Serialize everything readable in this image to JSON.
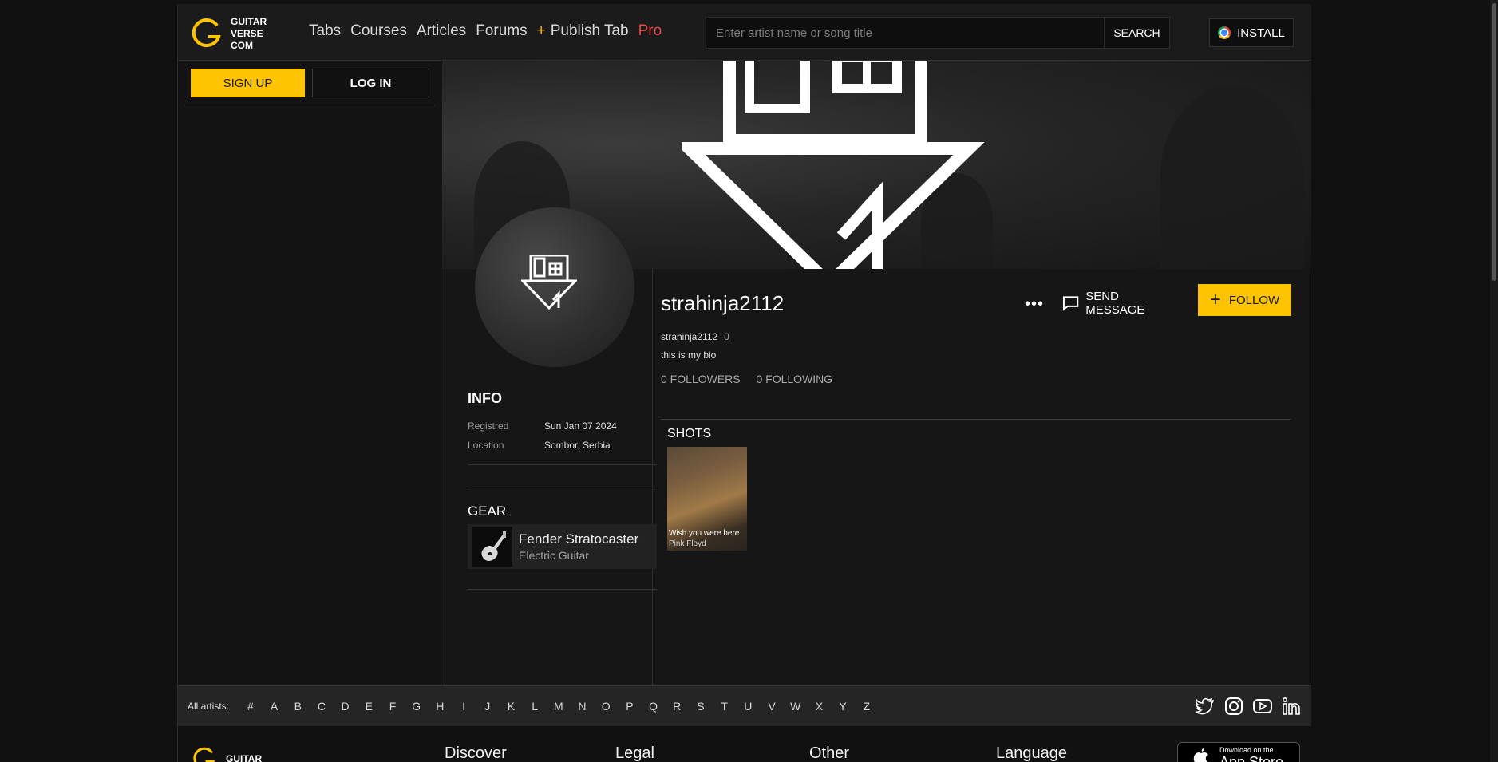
{
  "header": {
    "logo_text": "GUITAR\nVERSE\nCOM",
    "nav": {
      "tabs": "Tabs",
      "courses": "Courses",
      "articles": "Articles",
      "forums": "Forums",
      "publish_plus": "+",
      "publish": "Publish Tab",
      "pro": "Pro"
    },
    "search": {
      "placeholder": "Enter artist name or song title",
      "button": "SEARCH"
    },
    "install": "INSTALL"
  },
  "sidebar": {
    "signup": "SIGN UP",
    "login": "LOG IN"
  },
  "profile": {
    "username": "strahinja2112",
    "handle": "strahinja2112",
    "handle_count": "0",
    "bio": "this is my bio",
    "followers": "0 FOLLOWERS",
    "following": "0 FOLLOWING",
    "more": "•••",
    "send_message": "SEND MESSAGE",
    "follow": "FOLLOW"
  },
  "info": {
    "heading": "INFO",
    "registered_label": "Registred",
    "registered_value": "Sun Jan 07 2024",
    "location_label": "Location",
    "location_value": "Sombor, Serbia"
  },
  "gear": {
    "heading": "GEAR",
    "name": "Fender Stratocaster",
    "type": "Electric Guitar"
  },
  "shots": {
    "heading": "SHOTS",
    "items": [
      {
        "title": "Wish you were here",
        "artist": "Pink Floyd"
      }
    ]
  },
  "artists_bar": {
    "label": "All artists:",
    "letters": [
      "#",
      "A",
      "B",
      "C",
      "D",
      "E",
      "F",
      "G",
      "H",
      "I",
      "J",
      "K",
      "L",
      "M",
      "N",
      "O",
      "P",
      "Q",
      "R",
      "S",
      "T",
      "U",
      "V",
      "W",
      "X",
      "Y",
      "Z"
    ],
    "socials": [
      "twitter-icon",
      "instagram-icon",
      "youtube-icon",
      "linkedin-icon"
    ]
  },
  "footer": {
    "logo_text": "GUITAR",
    "discover": "Discover",
    "legal": "Legal",
    "other": "Other",
    "language": "Language",
    "appstore_small": "Download on the",
    "appstore_big": "App Store"
  },
  "colors": {
    "accent": "#ffc400",
    "pro": "#e44848",
    "background": "#111111"
  }
}
